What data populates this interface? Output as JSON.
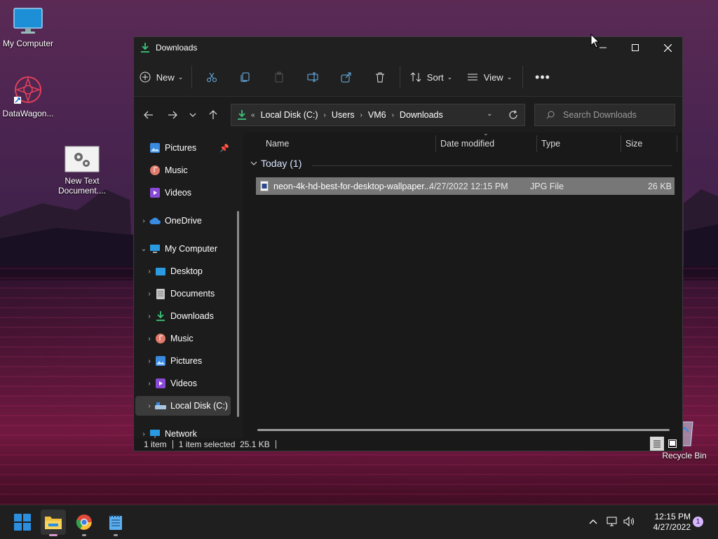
{
  "desktop": {
    "icons": [
      {
        "label": "My Computer"
      },
      {
        "label": "DataWagon..."
      },
      {
        "label": "New Text Document...."
      },
      {
        "label": "Recycle Bin"
      }
    ]
  },
  "window": {
    "title": "Downloads",
    "toolbar": {
      "new_label": "New",
      "sort_label": "Sort",
      "view_label": "View"
    },
    "breadcrumb": [
      "Local Disk (C:)",
      "Users",
      "VM6",
      "Downloads"
    ],
    "search": {
      "placeholder": "Search Downloads"
    },
    "nav": {
      "pinned": [
        {
          "label": "Pictures"
        },
        {
          "label": "Music"
        },
        {
          "label": "Videos"
        }
      ],
      "onedrive": "OneDrive",
      "my_computer": "My Computer",
      "children": [
        {
          "label": "Desktop"
        },
        {
          "label": "Documents"
        },
        {
          "label": "Downloads"
        },
        {
          "label": "Music"
        },
        {
          "label": "Pictures"
        },
        {
          "label": "Videos"
        },
        {
          "label": "Local Disk (C:)"
        }
      ],
      "network": "Network"
    },
    "columns": {
      "name": "Name",
      "date": "Date modified",
      "type": "Type",
      "size": "Size"
    },
    "group": {
      "label": "Today (1)"
    },
    "files": [
      {
        "name": "neon-4k-hd-best-for-desktop-wallpaper...",
        "date": "4/27/2022 12:15 PM",
        "type": "JPG File",
        "size": "26 KB"
      }
    ],
    "status": {
      "count": "1 item",
      "selected": "1 item selected  25.1 KB"
    }
  },
  "taskbar": {
    "time": "12:15 PM",
    "date": "4/27/2022",
    "notification_count": "1"
  },
  "colors": {
    "accent": "#0078d4",
    "selection": "#777777",
    "window_bg": "#191919"
  }
}
